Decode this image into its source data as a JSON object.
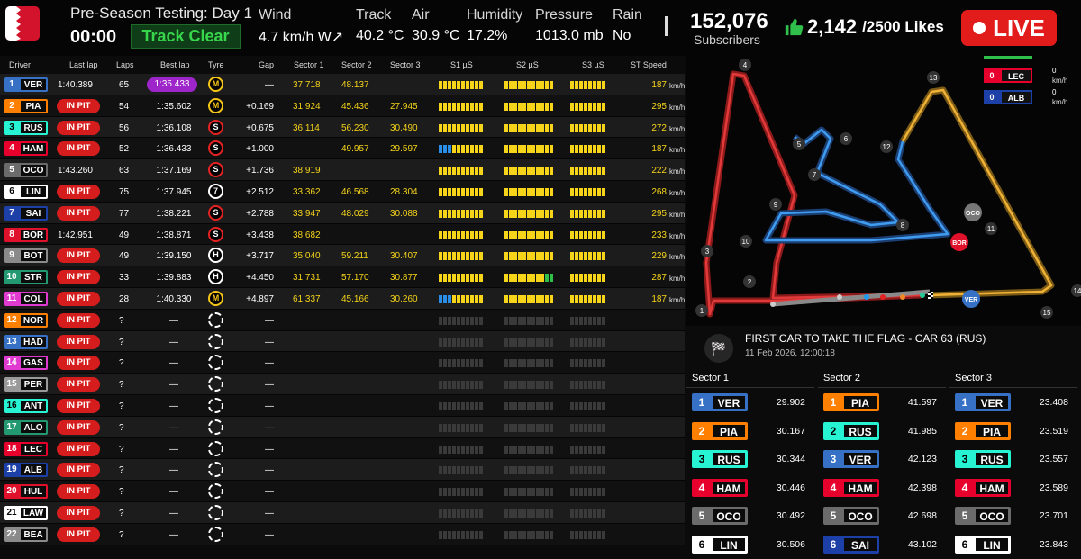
{
  "header": {
    "session_title": "Pre-Season Testing: Day 1",
    "session_time": "00:00",
    "track_status": "Track Clear",
    "weather": [
      {
        "label": "Wind",
        "value": "4.7 km/h W↗"
      },
      {
        "label": "Track",
        "value": "40.2 °C"
      },
      {
        "label": "Air",
        "value": "30.9 °C"
      },
      {
        "label": "Humidity",
        "value": "17.2%"
      },
      {
        "label": "Pressure",
        "value": "1013.0 mb"
      },
      {
        "label": "Rain",
        "value": "No"
      }
    ],
    "subscribers_count": "152,076",
    "subscribers_label": "Subscribers",
    "likes_count": "2,142",
    "likes_total": "/2500 Likes",
    "live_label": "LIVE"
  },
  "table": {
    "columns": [
      "Driver",
      "Last lap",
      "Laps",
      "Best lap",
      "Tyre",
      "Gap",
      "Sector 1",
      "Sector 2",
      "Sector 3",
      "S1 µS",
      "S2 µS",
      "S3 µS",
      "ST Speed"
    ],
    "speed_unit": "km/h",
    "rows": [
      {
        "pos": "1",
        "tla": "VER",
        "color": "#3671C6",
        "last": "1:40.389",
        "pit": "",
        "laps": "65",
        "best": "1:35.433",
        "best_purple": true,
        "tyre": "M",
        "gap": "—",
        "s1": "37.718",
        "s2": "48.137",
        "s3": "",
        "st": "187"
      },
      {
        "pos": "2",
        "tla": "PIA",
        "color": "#FF8000",
        "last": "",
        "pit": "IN PIT",
        "laps": "54",
        "best": "1:35.602",
        "tyre": "M",
        "gap": "+0.169",
        "s1": "31.924",
        "s2": "45.436",
        "s3": "27.945",
        "st": "295"
      },
      {
        "pos": "3",
        "tla": "RUS",
        "color": "#27F4D2",
        "last": "",
        "pit": "IN PIT",
        "laps": "56",
        "best": "1:36.108",
        "tyre": "S",
        "gap": "+0.675",
        "s1": "36.114",
        "s2": "56.230",
        "s3": "30.490",
        "st": "272"
      },
      {
        "pos": "4",
        "tla": "HAM",
        "color": "#E8002D",
        "last": "",
        "pit": "IN PIT",
        "laps": "52",
        "best": "1:36.433",
        "tyre": "S",
        "gap": "+1.000",
        "s1": "",
        "s2": "49.957",
        "s3": "29.597",
        "st": "187"
      },
      {
        "pos": "5",
        "tla": "OCO",
        "color": "#6b6b6b",
        "last": "1:43.260",
        "pit": "",
        "laps": "63",
        "best": "1:37.169",
        "tyre": "S",
        "gap": "+1.736",
        "s1": "38.919",
        "s2": "",
        "s3": "",
        "st": "222"
      },
      {
        "pos": "6",
        "tla": "LIN",
        "color": "#ffffff",
        "last": "",
        "pit": "IN PIT",
        "laps": "75",
        "best": "1:37.945",
        "tyre": "7",
        "gap": "+2.512",
        "s1": "33.362",
        "s2": "46.568",
        "s3": "28.304",
        "st": "268"
      },
      {
        "pos": "7",
        "tla": "SAI",
        "color": "#1d3fa8",
        "last": "",
        "pit": "IN PIT",
        "laps": "77",
        "best": "1:38.221",
        "tyre": "S",
        "gap": "+2.788",
        "s1": "33.947",
        "s2": "48.029",
        "s3": "30.088",
        "st": "295"
      },
      {
        "pos": "8",
        "tla": "BOR",
        "color": "#e0112b",
        "last": "1:42.951",
        "pit": "",
        "laps": "49",
        "best": "1:38.871",
        "tyre": "S",
        "gap": "+3.438",
        "s1": "38.682",
        "s2": "",
        "s3": "",
        "st": "233"
      },
      {
        "pos": "9",
        "tla": "BOT",
        "color": "#8a8a8a",
        "last": "",
        "pit": "IN PIT",
        "laps": "49",
        "best": "1:39.150",
        "tyre": "H",
        "gap": "+3.717",
        "s1": "35.040",
        "s2": "59.211",
        "s3": "30.407",
        "st": "229"
      },
      {
        "pos": "10",
        "tla": "STR",
        "color": "#229971",
        "last": "",
        "pit": "IN PIT",
        "laps": "33",
        "best": "1:39.883",
        "tyre": "H",
        "gap": "+4.450",
        "s1": "31.731",
        "s2": "57.170",
        "s3": "30.877",
        "st": "287"
      },
      {
        "pos": "11",
        "tla": "COL",
        "color": "#e03ad0",
        "last": "",
        "pit": "IN PIT",
        "laps": "28",
        "best": "1:40.330",
        "tyre": "M",
        "gap": "+4.897",
        "s1": "61.337",
        "s2": "45.166",
        "s3": "30.260",
        "st": "187"
      },
      {
        "pos": "12",
        "tla": "NOR",
        "color": "#FF8000",
        "last": "",
        "pit": "IN PIT",
        "laps": "?",
        "best": "—",
        "tyre": "U",
        "gap": "—",
        "s1": "",
        "s2": "",
        "s3": "",
        "st": ""
      },
      {
        "pos": "13",
        "tla": "HAD",
        "color": "#3671C6",
        "last": "",
        "pit": "IN PIT",
        "laps": "?",
        "best": "—",
        "tyre": "U",
        "gap": "—",
        "s1": "",
        "s2": "",
        "s3": "",
        "st": ""
      },
      {
        "pos": "14",
        "tla": "GAS",
        "color": "#e03ad0",
        "last": "",
        "pit": "IN PIT",
        "laps": "?",
        "best": "—",
        "tyre": "U",
        "gap": "—",
        "s1": "",
        "s2": "",
        "s3": "",
        "st": ""
      },
      {
        "pos": "15",
        "tla": "PER",
        "color": "#9a9a9a",
        "last": "",
        "pit": "IN PIT",
        "laps": "?",
        "best": "—",
        "tyre": "U",
        "gap": "—",
        "s1": "",
        "s2": "",
        "s3": "",
        "st": ""
      },
      {
        "pos": "16",
        "tla": "ANT",
        "color": "#27F4D2",
        "last": "",
        "pit": "IN PIT",
        "laps": "?",
        "best": "—",
        "tyre": "U",
        "gap": "—",
        "s1": "",
        "s2": "",
        "s3": "",
        "st": ""
      },
      {
        "pos": "17",
        "tla": "ALO",
        "color": "#229971",
        "last": "",
        "pit": "IN PIT",
        "laps": "?",
        "best": "—",
        "tyre": "U",
        "gap": "—",
        "s1": "",
        "s2": "",
        "s3": "",
        "st": ""
      },
      {
        "pos": "18",
        "tla": "LEC",
        "color": "#E8002D",
        "last": "",
        "pit": "IN PIT",
        "laps": "?",
        "best": "—",
        "tyre": "U",
        "gap": "—",
        "s1": "",
        "s2": "",
        "s3": "",
        "st": ""
      },
      {
        "pos": "19",
        "tla": "ALB",
        "color": "#1d3fa8",
        "last": "",
        "pit": "IN PIT",
        "laps": "?",
        "best": "—",
        "tyre": "U",
        "gap": "—",
        "s1": "",
        "s2": "",
        "s3": "",
        "st": ""
      },
      {
        "pos": "20",
        "tla": "HUL",
        "color": "#e0112b",
        "last": "",
        "pit": "IN PIT",
        "laps": "?",
        "best": "—",
        "tyre": "U",
        "gap": "—",
        "s1": "",
        "s2": "",
        "s3": "",
        "st": ""
      },
      {
        "pos": "21",
        "tla": "LAW",
        "color": "#ffffff",
        "last": "",
        "pit": "IN PIT",
        "laps": "?",
        "best": "—",
        "tyre": "U",
        "gap": "—",
        "s1": "",
        "s2": "",
        "s3": "",
        "st": ""
      },
      {
        "pos": "22",
        "tla": "BEA",
        "color": "#8a8a8a",
        "last": "",
        "pit": "IN PIT",
        "laps": "?",
        "best": "—",
        "tyre": "U",
        "gap": "—",
        "s1": "",
        "s2": "",
        "s3": "",
        "st": ""
      }
    ]
  },
  "mini_board": [
    {
      "pos": "0",
      "tla": "LEC",
      "color": "#E8002D",
      "value": "0",
      "unit": "km/h"
    },
    {
      "pos": "0",
      "tla": "ALB",
      "color": "#1d3fa8",
      "value": "0",
      "unit": "km/h"
    }
  ],
  "map": {
    "corners": [
      "1",
      "2",
      "3",
      "4",
      "5",
      "6",
      "7",
      "8",
      "9",
      "10",
      "11",
      "12",
      "13",
      "14",
      "15"
    ],
    "cars": [
      {
        "tla": "VER",
        "color": "#3671C6"
      },
      {
        "tla": "BOR",
        "color": "#e0112b"
      },
      {
        "tla": "OCO",
        "color": "#777777"
      }
    ]
  },
  "flag_message": {
    "title": "FIRST CAR TO TAKE THE FLAG - CAR 63 (RUS)",
    "date": "11 Feb 2026, 12:00:18"
  },
  "sectors": [
    {
      "title": "Sector 1",
      "rows": [
        {
          "pos": "1",
          "tla": "VER",
          "color": "#3671C6",
          "time": "29.902"
        },
        {
          "pos": "2",
          "tla": "PIA",
          "color": "#FF8000",
          "time": "30.167"
        },
        {
          "pos": "3",
          "tla": "RUS",
          "color": "#27F4D2",
          "time": "30.344"
        },
        {
          "pos": "4",
          "tla": "HAM",
          "color": "#E8002D",
          "time": "30.446"
        },
        {
          "pos": "5",
          "tla": "OCO",
          "color": "#6b6b6b",
          "time": "30.492"
        },
        {
          "pos": "6",
          "tla": "LIN",
          "color": "#ffffff",
          "time": "30.506"
        }
      ]
    },
    {
      "title": "Sector 2",
      "rows": [
        {
          "pos": "1",
          "tla": "PIA",
          "color": "#FF8000",
          "time": "41.597"
        },
        {
          "pos": "2",
          "tla": "RUS",
          "color": "#27F4D2",
          "time": "41.985"
        },
        {
          "pos": "3",
          "tla": "VER",
          "color": "#3671C6",
          "time": "42.123"
        },
        {
          "pos": "4",
          "tla": "HAM",
          "color": "#E8002D",
          "time": "42.398"
        },
        {
          "pos": "5",
          "tla": "OCO",
          "color": "#6b6b6b",
          "time": "42.698"
        },
        {
          "pos": "6",
          "tla": "SAI",
          "color": "#1d3fa8",
          "time": "43.102"
        }
      ]
    },
    {
      "title": "Sector 3",
      "rows": [
        {
          "pos": "1",
          "tla": "VER",
          "color": "#3671C6",
          "time": "23.408"
        },
        {
          "pos": "2",
          "tla": "PIA",
          "color": "#FF8000",
          "time": "23.519"
        },
        {
          "pos": "3",
          "tla": "RUS",
          "color": "#27F4D2",
          "time": "23.557"
        },
        {
          "pos": "4",
          "tla": "HAM",
          "color": "#E8002D",
          "time": "23.589"
        },
        {
          "pos": "5",
          "tla": "OCO",
          "color": "#6b6b6b",
          "time": "23.701"
        },
        {
          "pos": "6",
          "tla": "LIN",
          "color": "#ffffff",
          "time": "23.843"
        }
      ]
    }
  ]
}
